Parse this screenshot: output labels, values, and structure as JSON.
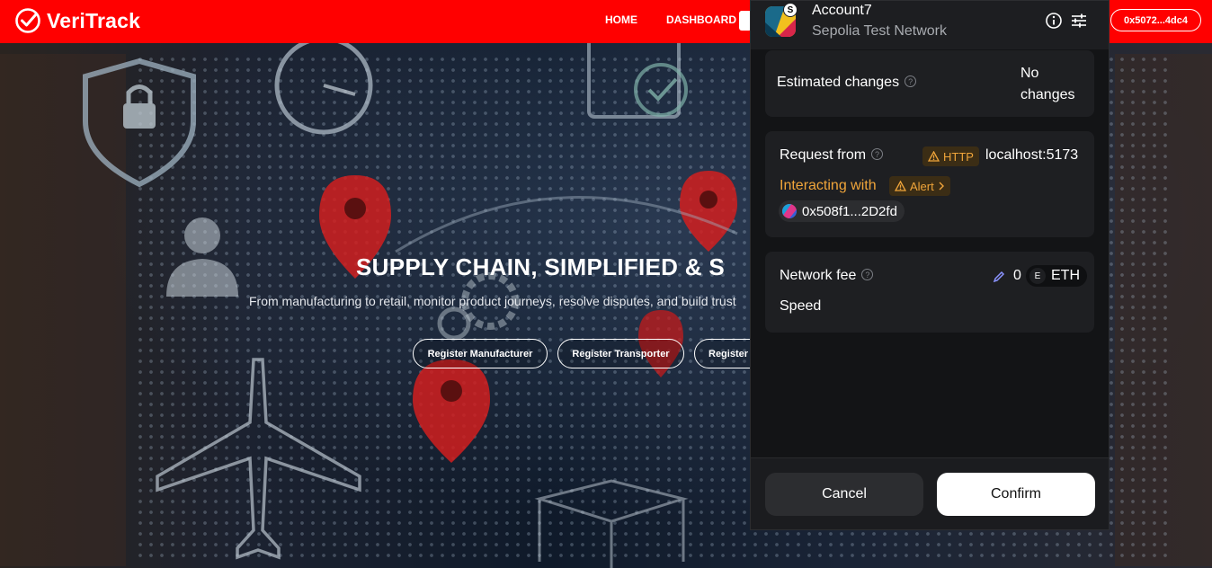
{
  "navbar": {
    "brand": "VeriTrack",
    "links": [
      "HOME",
      "DASHBOARD"
    ],
    "wallet_address": "0x5072...4dc4"
  },
  "hero": {
    "title": "SUPPLY CHAIN, SIMPLIFIED & S",
    "subtitle": "From manufacturing to retail, monitor product journeys, resolve disputes, and build trust",
    "buttons": [
      "Register Manufacturer",
      "Register Transporter",
      "Register"
    ]
  },
  "popup": {
    "account_name": "Account7",
    "network": "Sepolia Test Network",
    "network_badge": "S",
    "estimated_changes": {
      "label": "Estimated changes",
      "value": "No changes"
    },
    "request": {
      "label": "Request from",
      "protocol_tag": "HTTP",
      "origin": "localhost:5173",
      "interacting_label": "Interacting with",
      "alert_tag": "Alert",
      "contract_address": "0x508f1...2D2fd"
    },
    "fee": {
      "label": "Network fee",
      "amount": "0",
      "currency": "ETH",
      "currency_badge": "E",
      "speed_label": "Speed"
    },
    "actions": {
      "cancel": "Cancel",
      "confirm": "Confirm"
    }
  },
  "colors": {
    "brand_red": "#ff0000",
    "warning": "#f0a53a",
    "popup_bg": "#131416",
    "card_bg": "#1e1f22"
  },
  "icons": [
    "check-circle-icon",
    "info-icon",
    "settings-sliders-icon",
    "question-icon",
    "warning-icon",
    "chevron-right-icon",
    "pencil-icon"
  ]
}
